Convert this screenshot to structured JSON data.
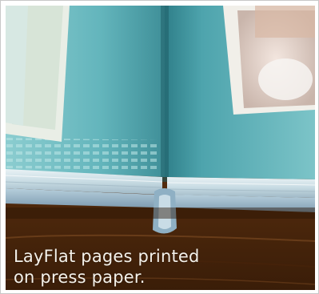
{
  "image": {
    "subject": "layflat-photo-book"
  },
  "caption": {
    "line1": "LayFlat pages printed",
    "line2": "on press paper."
  },
  "colors": {
    "page_teal": "#5fb3bb",
    "page_teal_light": "#8fd0d4",
    "table_wood": "#6a3a14",
    "caption_text": "#f4f1ea",
    "frame_border": "#c8c8c8"
  }
}
